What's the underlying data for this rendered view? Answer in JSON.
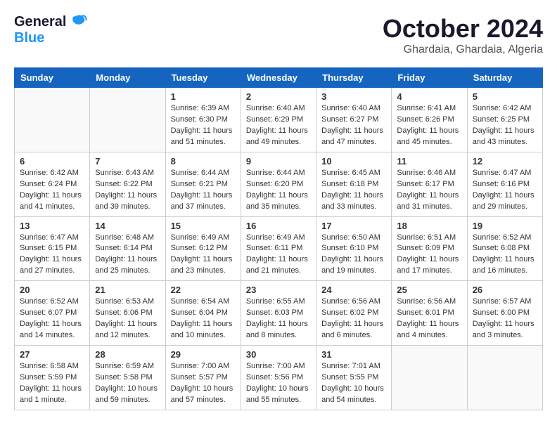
{
  "header": {
    "logo_general": "General",
    "logo_blue": "Blue",
    "month_title": "October 2024",
    "subtitle": "Ghardaia, Ghardaia, Algeria"
  },
  "days_of_week": [
    "Sunday",
    "Monday",
    "Tuesday",
    "Wednesday",
    "Thursday",
    "Friday",
    "Saturday"
  ],
  "weeks": [
    [
      {
        "day": "",
        "info": ""
      },
      {
        "day": "",
        "info": ""
      },
      {
        "day": "1",
        "info": "Sunrise: 6:39 AM\nSunset: 6:30 PM\nDaylight: 11 hours and 51 minutes."
      },
      {
        "day": "2",
        "info": "Sunrise: 6:40 AM\nSunset: 6:29 PM\nDaylight: 11 hours and 49 minutes."
      },
      {
        "day": "3",
        "info": "Sunrise: 6:40 AM\nSunset: 6:27 PM\nDaylight: 11 hours and 47 minutes."
      },
      {
        "day": "4",
        "info": "Sunrise: 6:41 AM\nSunset: 6:26 PM\nDaylight: 11 hours and 45 minutes."
      },
      {
        "day": "5",
        "info": "Sunrise: 6:42 AM\nSunset: 6:25 PM\nDaylight: 11 hours and 43 minutes."
      }
    ],
    [
      {
        "day": "6",
        "info": "Sunrise: 6:42 AM\nSunset: 6:24 PM\nDaylight: 11 hours and 41 minutes."
      },
      {
        "day": "7",
        "info": "Sunrise: 6:43 AM\nSunset: 6:22 PM\nDaylight: 11 hours and 39 minutes."
      },
      {
        "day": "8",
        "info": "Sunrise: 6:44 AM\nSunset: 6:21 PM\nDaylight: 11 hours and 37 minutes."
      },
      {
        "day": "9",
        "info": "Sunrise: 6:44 AM\nSunset: 6:20 PM\nDaylight: 11 hours and 35 minutes."
      },
      {
        "day": "10",
        "info": "Sunrise: 6:45 AM\nSunset: 6:18 PM\nDaylight: 11 hours and 33 minutes."
      },
      {
        "day": "11",
        "info": "Sunrise: 6:46 AM\nSunset: 6:17 PM\nDaylight: 11 hours and 31 minutes."
      },
      {
        "day": "12",
        "info": "Sunrise: 6:47 AM\nSunset: 6:16 PM\nDaylight: 11 hours and 29 minutes."
      }
    ],
    [
      {
        "day": "13",
        "info": "Sunrise: 6:47 AM\nSunset: 6:15 PM\nDaylight: 11 hours and 27 minutes."
      },
      {
        "day": "14",
        "info": "Sunrise: 6:48 AM\nSunset: 6:14 PM\nDaylight: 11 hours and 25 minutes."
      },
      {
        "day": "15",
        "info": "Sunrise: 6:49 AM\nSunset: 6:12 PM\nDaylight: 11 hours and 23 minutes."
      },
      {
        "day": "16",
        "info": "Sunrise: 6:49 AM\nSunset: 6:11 PM\nDaylight: 11 hours and 21 minutes."
      },
      {
        "day": "17",
        "info": "Sunrise: 6:50 AM\nSunset: 6:10 PM\nDaylight: 11 hours and 19 minutes."
      },
      {
        "day": "18",
        "info": "Sunrise: 6:51 AM\nSunset: 6:09 PM\nDaylight: 11 hours and 17 minutes."
      },
      {
        "day": "19",
        "info": "Sunrise: 6:52 AM\nSunset: 6:08 PM\nDaylight: 11 hours and 16 minutes."
      }
    ],
    [
      {
        "day": "20",
        "info": "Sunrise: 6:52 AM\nSunset: 6:07 PM\nDaylight: 11 hours and 14 minutes."
      },
      {
        "day": "21",
        "info": "Sunrise: 6:53 AM\nSunset: 6:06 PM\nDaylight: 11 hours and 12 minutes."
      },
      {
        "day": "22",
        "info": "Sunrise: 6:54 AM\nSunset: 6:04 PM\nDaylight: 11 hours and 10 minutes."
      },
      {
        "day": "23",
        "info": "Sunrise: 6:55 AM\nSunset: 6:03 PM\nDaylight: 11 hours and 8 minutes."
      },
      {
        "day": "24",
        "info": "Sunrise: 6:56 AM\nSunset: 6:02 PM\nDaylight: 11 hours and 6 minutes."
      },
      {
        "day": "25",
        "info": "Sunrise: 6:56 AM\nSunset: 6:01 PM\nDaylight: 11 hours and 4 minutes."
      },
      {
        "day": "26",
        "info": "Sunrise: 6:57 AM\nSunset: 6:00 PM\nDaylight: 11 hours and 3 minutes."
      }
    ],
    [
      {
        "day": "27",
        "info": "Sunrise: 6:58 AM\nSunset: 5:59 PM\nDaylight: 11 hours and 1 minute."
      },
      {
        "day": "28",
        "info": "Sunrise: 6:59 AM\nSunset: 5:58 PM\nDaylight: 10 hours and 59 minutes."
      },
      {
        "day": "29",
        "info": "Sunrise: 7:00 AM\nSunset: 5:57 PM\nDaylight: 10 hours and 57 minutes."
      },
      {
        "day": "30",
        "info": "Sunrise: 7:00 AM\nSunset: 5:56 PM\nDaylight: 10 hours and 55 minutes."
      },
      {
        "day": "31",
        "info": "Sunrise: 7:01 AM\nSunset: 5:55 PM\nDaylight: 10 hours and 54 minutes."
      },
      {
        "day": "",
        "info": ""
      },
      {
        "day": "",
        "info": ""
      }
    ]
  ]
}
